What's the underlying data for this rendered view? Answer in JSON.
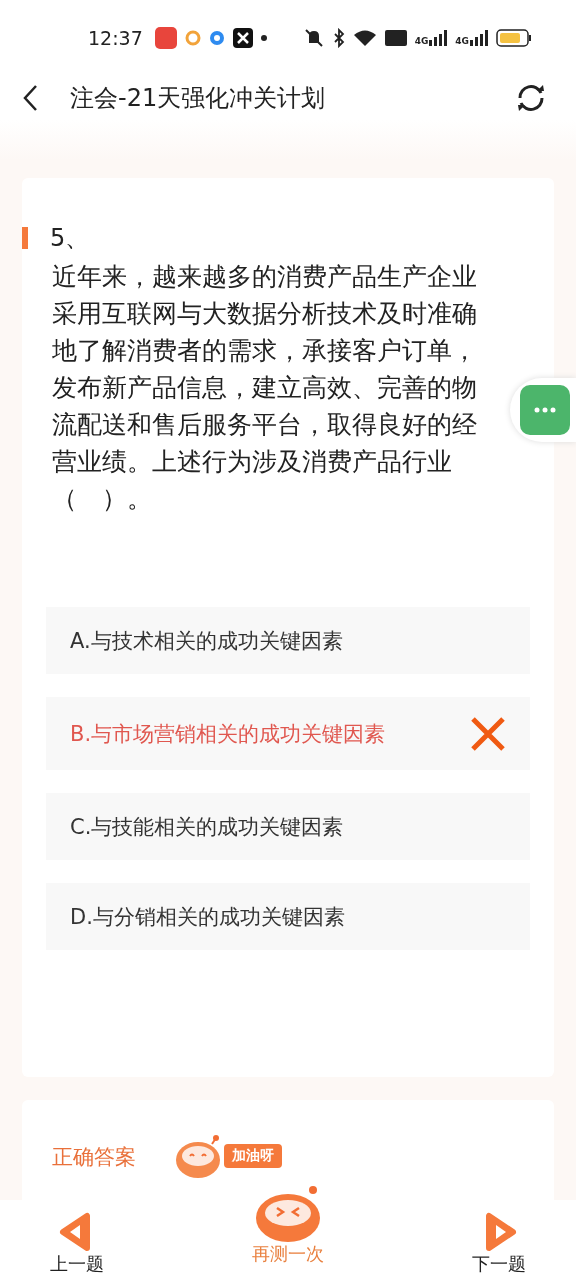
{
  "status_bar": {
    "time": "12:37",
    "network": [
      "4G",
      "4G"
    ]
  },
  "header": {
    "title": "注会-21天强化冲关计划"
  },
  "question": {
    "number": "5、",
    "text": "近年来，越来越多的消费产品生产企业采用互联网与大数据分析技术及时准确地了解消费者的需求，承接客户订单，发布新产品信息，建立高效、完善的物流配送和售后服务平台，取得良好的经营业绩。上述行为涉及消费产品行业（　）。",
    "options": [
      {
        "label": "A.与技术相关的成功关键因素",
        "selected": false
      },
      {
        "label": "B.与市场营销相关的成功关键因素",
        "selected": true
      },
      {
        "label": "C.与技能相关的成功关键因素",
        "selected": false
      },
      {
        "label": "D.与分销相关的成功关键因素",
        "selected": false
      }
    ]
  },
  "answer": {
    "title": "正确答案",
    "bubble": "加油呀"
  },
  "bottom_nav": {
    "prev": "上一题",
    "retry": "再测一次",
    "next": "下一题"
  }
}
